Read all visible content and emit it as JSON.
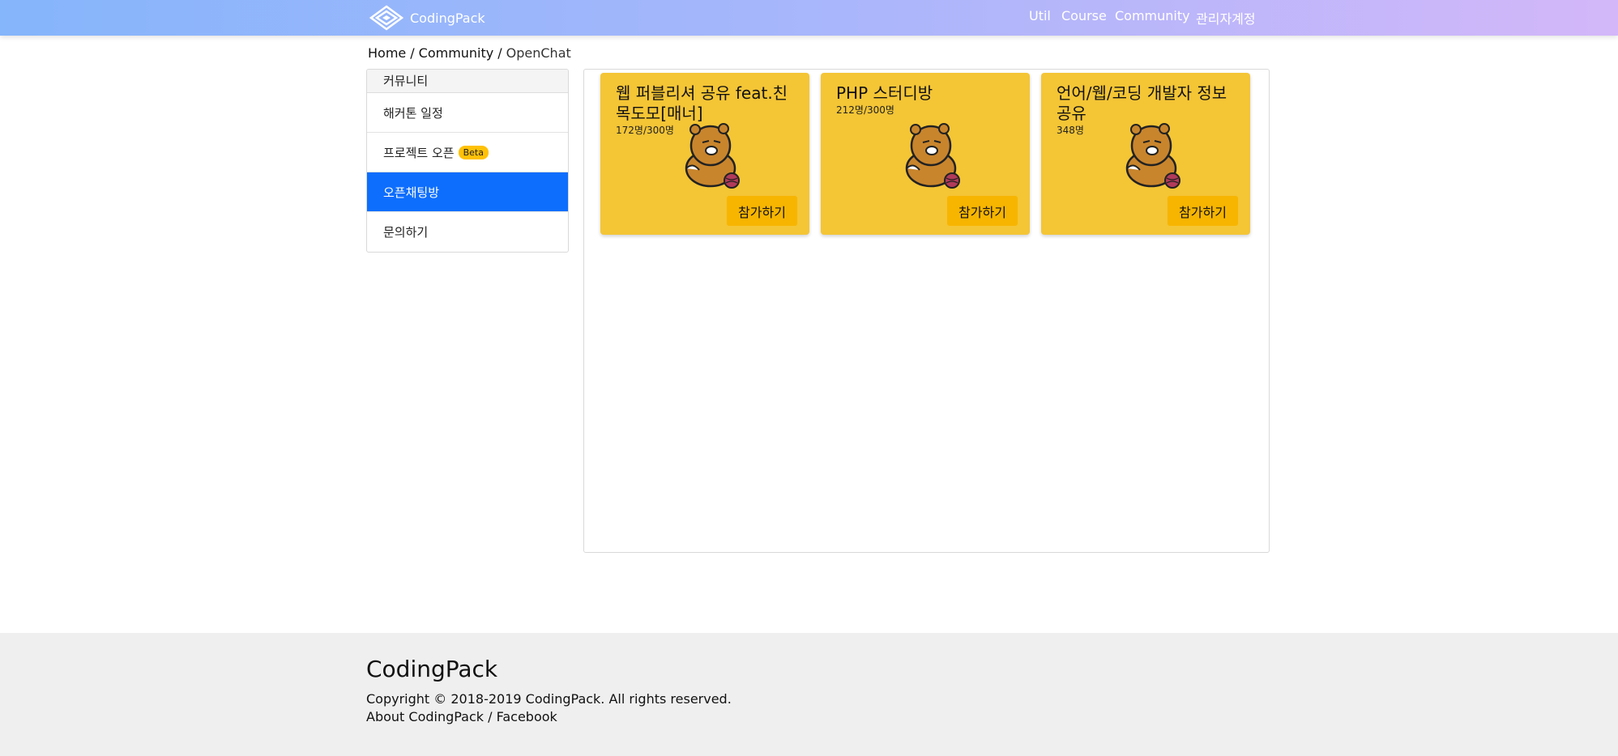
{
  "navbar": {
    "brand": "CodingPack",
    "links": [
      "Util",
      "Course",
      "Community",
      "관리자계정"
    ]
  },
  "breadcrumb": {
    "items": [
      "Home",
      "Community",
      "OpenChat"
    ],
    "separator": "/"
  },
  "sidebar": {
    "header": "커뮤니티",
    "items": [
      {
        "label": "해커톤 일정",
        "badge": ""
      },
      {
        "label": "프로젝트 오픈",
        "badge": "Beta"
      },
      {
        "label": "오픈채팅방",
        "badge": "",
        "active": true
      },
      {
        "label": "문의하기",
        "badge": ""
      }
    ]
  },
  "cards": [
    {
      "title": "웹 퍼블리셔 공유 feat.친목도모[매너]",
      "count": "172명/300명",
      "button": "참가하기",
      "image": "bear-character"
    },
    {
      "title": "PHP 스터디방",
      "count": "212명/300명",
      "button": "참가하기",
      "image": "bear-character"
    },
    {
      "title": "언어/웹/코딩 개발자 정보공유",
      "count": "348명",
      "button": "참가하기",
      "image": "bear-character"
    }
  ],
  "footer": {
    "title": "CodingPack",
    "copyright": "Copyright © 2018-2019 CodingPack. All rights reserved.",
    "links": [
      "About CodingPack",
      "Facebook"
    ],
    "separator": "/"
  },
  "colors": {
    "nav_gradient_start": "#85b5fb",
    "nav_gradient_end": "#d3b7f9",
    "active_item": "#0d6efd",
    "card_bg": "#f4c535",
    "button_bg": "#f7b500",
    "badge_bg": "#ffc107",
    "footer_bg": "#efefef"
  }
}
